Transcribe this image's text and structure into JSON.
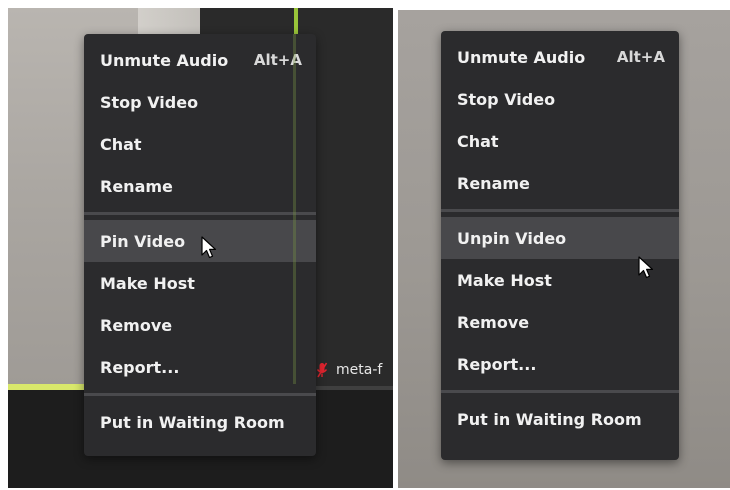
{
  "left": {
    "menu": {
      "items": [
        {
          "label": "Unmute Audio",
          "shortcut": "Alt+A"
        },
        {
          "label": "Stop Video"
        },
        {
          "label": "Chat"
        },
        {
          "label": "Rename"
        },
        {
          "label": "Pin Video"
        },
        {
          "label": "Make Host"
        },
        {
          "label": "Remove"
        },
        {
          "label": "Report..."
        },
        {
          "label": "Put in Waiting Room"
        }
      ]
    },
    "participant_name": "meta-f"
  },
  "right": {
    "menu": {
      "items": [
        {
          "label": "Unmute Audio",
          "shortcut": "Alt+A"
        },
        {
          "label": "Stop Video"
        },
        {
          "label": "Chat"
        },
        {
          "label": "Rename"
        },
        {
          "label": "Unpin Video"
        },
        {
          "label": "Make Host"
        },
        {
          "label": "Remove"
        },
        {
          "label": "Report..."
        },
        {
          "label": "Put in Waiting Room"
        }
      ]
    }
  },
  "colors": {
    "menu_bg": "#2b2b2d",
    "menu_hover": "#48484b",
    "menu_text": "#f1f1f1",
    "separator": "#4a4a4d",
    "tile_border_green": "#9ac53a",
    "tile_border_yellow": "#d9e86b",
    "muted_mic_red": "#e0242f"
  },
  "icons": {
    "cursor": "arrow-cursor-icon",
    "mic": "mic-muted-icon"
  }
}
